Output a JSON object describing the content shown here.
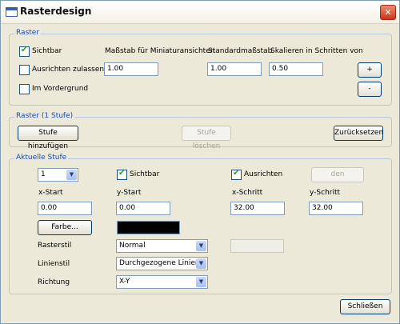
{
  "window": {
    "title": "Rasterdesign",
    "close_glyph": "✕"
  },
  "raster": {
    "legend": "Raster",
    "visible_label": "Sichtbar",
    "align_label": "Ausrichten zulassen",
    "foreground_label": "Im Vordergrund",
    "scale_preview_label": "Maßstab für Miniaturansichten",
    "scale_preview_value": "1.00",
    "standard_scale_label": "Standardmaßstab",
    "standard_scale_value": "1.00",
    "step_scale_label": "Skalieren in Schritten von",
    "step_scale_value": "0.50",
    "plus_label": "+",
    "minus_label": "-",
    "visible_checked": true,
    "align_checked": false,
    "foreground_checked": false
  },
  "levels": {
    "legend": "Raster (1 Stufe)",
    "add_label": "Stufe hinzufügen",
    "delete_label": "Stufe löschen",
    "reset_label": "Zurücksetzen"
  },
  "current": {
    "legend": "Aktuelle Stufe",
    "level_value": "1",
    "visible_label": "Sichtbar",
    "visible_checked": true,
    "align_label": "Ausrichten",
    "align_checked": true,
    "foreground_btn_label": "den Vordergru",
    "x_start_label": "x-Start",
    "x_start_value": "0.00",
    "y_start_label": "y-Start",
    "y_start_value": "0.00",
    "x_step_label": "x-Schritt",
    "x_step_value": "32.00",
    "y_step_label": "y-Schritt",
    "y_step_value": "32.00",
    "color_label": "Farbe...",
    "color_value": "#000000",
    "raster_style_label": "Rasterstil",
    "raster_style_value": "Normal",
    "line_style_label": "Linienstil",
    "line_style_value": "Durchgezogene Linien",
    "direction_label": "Richtung",
    "direction_value": "X-Y",
    "dropdown_arrow": "▼"
  },
  "footer": {
    "close_label": "Schließen"
  }
}
